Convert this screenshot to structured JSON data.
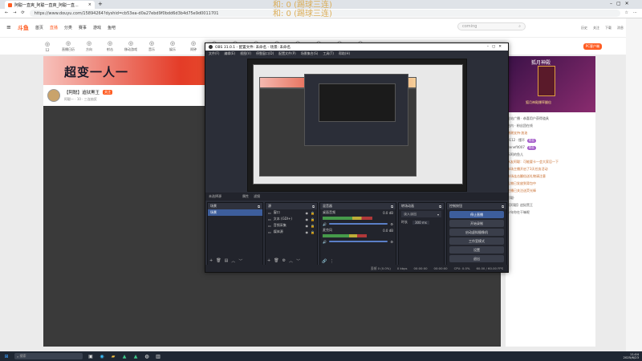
{
  "browser": {
    "tab_title": "阿聪一直爽_阿聪一直爽_阿聪一直...",
    "url": "https://www.douyu.com/15894264?dyshid=cb53ea-d0a27ebd9f0bdd6d3b4d75e9d0011701",
    "close_glyph": "×",
    "new_tab_glyph": "+"
  },
  "overlay_text": [
    "和: 0 (踢球三连)",
    "和: 0 (踢球三连)"
  ],
  "site": {
    "logo": "斗鱼",
    "nav": [
      "首页",
      "直播",
      "分类",
      "赛事",
      "游戏",
      "鱼吧"
    ],
    "search_placeholder": "coming",
    "header_icons": [
      "历史",
      "关注",
      "下载",
      "消息",
      "个人"
    ],
    "categories": [
      {
        "label": "12",
        "sub": "直播中"
      },
      {
        "label": "直播日历",
        "sub": ""
      },
      {
        "label": "方向",
        "sub": ""
      },
      {
        "label": "射击",
        "sub": ""
      },
      {
        "label": "移动游戏",
        "sub": ""
      },
      {
        "label": "音乐",
        "sub": ""
      },
      {
        "label": "娱乐",
        "sub": ""
      },
      {
        "label": "闹钟",
        "sub": ""
      },
      {
        "label": "体育",
        "sub": ""
      },
      {
        "label": "综合",
        "sub": ""
      },
      {
        "label": "汽车",
        "sub": ""
      },
      {
        "label": "虚拟",
        "sub": ""
      },
      {
        "label": "户外",
        "sub": ""
      },
      {
        "label": "游戏",
        "sub": ""
      },
      {
        "label": "生活",
        "sub": ""
      },
      {
        "label": "其他",
        "sub": ""
      }
    ],
    "pc_client": "PC客户端",
    "banner_text": "超变一人一",
    "room_name": "【阿聪】追狱黑王",
    "room_meta": "阿聪一 · 10 · 三连抽奖",
    "follow_label": "关注",
    "right_panel": {
      "title": "狐月神殿",
      "subtitle": "狐月神殿爆率翻倍",
      "chat": [
        {
          "text": "全站广播 · 恭喜用户获得道具",
          "hl": false,
          "pill": ""
        },
        {
          "text": "站内 · 粉丝团在线",
          "hl": false,
          "pill": ""
        },
        {
          "text": "谢谢支持·加油",
          "hl": true,
          "pill": ""
        },
        {
          "text": "0112 · 懂不",
          "hl": false,
          "pill": "粉丝"
        },
        {
          "text": "Benefit007",
          "hl": false,
          "pill": "粉丝"
        },
        {
          "text": "乐呵的鱼儿",
          "hl": false,
          "pill": ""
        },
        {
          "text": "水友阿聪：可能要卡一会大家忍一下",
          "hl": true,
          "pill": ""
        },
        {
          "text": "本场主播开启了3天任务活动",
          "hl": true,
          "pill": ""
        },
        {
          "text": "本场连击翻倍送礼物请注意",
          "hl": true,
          "pill": ""
        },
        {
          "text": "礼物已发放到背包中",
          "hl": true,
          "pill": ""
        },
        {
          "text": "主播已关注送荧光棒",
          "hl": true,
          "pill": ""
        },
        {
          "text": "阿聪·",
          "hl": false,
          "pill": ""
        },
        {
          "text": "【阿聪】追狱黑王",
          "hl": false,
          "pill": ""
        },
        {
          "text": "少年你在干嘛呢",
          "hl": false,
          "pill": ""
        }
      ]
    }
  },
  "obs": {
    "title": "OBS 31.0.1 - 配置文件: 未命名 - 场景: 未命名",
    "menu": [
      "文件(F)",
      "编辑(E)",
      "视图(V)",
      "停靠窗口(D)",
      "配置文件(P)",
      "场景集合(S)",
      "工具(T)",
      "帮助(H)"
    ],
    "scene_bar": [
      "未选择源",
      "属性",
      "滤镜"
    ],
    "docks": {
      "scenes": {
        "title": "场景",
        "items": [
          "场景"
        ]
      },
      "sources": {
        "title": "源",
        "items": [
          "窗口",
          "文本 (GDI+)",
          "音频采集",
          "媒体源"
        ]
      },
      "mixer": {
        "title": "混音器",
        "tracks": [
          {
            "name": "桌面音频",
            "db": "0.0 dB",
            "level": 0.72
          },
          {
            "name": "麦克风",
            "db": "0.0 dB",
            "level": 0.65
          }
        ]
      },
      "transitions": {
        "title": "转场动画",
        "type": "淡入淡出",
        "duration_label": "时长",
        "duration": "300 ms"
      },
      "controls": {
        "title": "控制按钮",
        "buttons": [
          "停止直播",
          "开始录制",
          "启动虚拟摄像机",
          "工作室模式",
          "设置",
          "退出"
        ]
      }
    },
    "status": [
      "丢帧 0 (0.0%)",
      "0 kbps",
      "00:00:00",
      "00:00:00",
      "CPU: 0.0%",
      "60.00 / 60.00 FPS"
    ]
  },
  "taskbar": {
    "search_placeholder": "搜索",
    "time": "11:04",
    "date": "2025/6/23"
  },
  "colors": {
    "accent": "#ff5d23",
    "obs_bg": "#2b2e38",
    "obs_select": "#3d5e9c"
  }
}
